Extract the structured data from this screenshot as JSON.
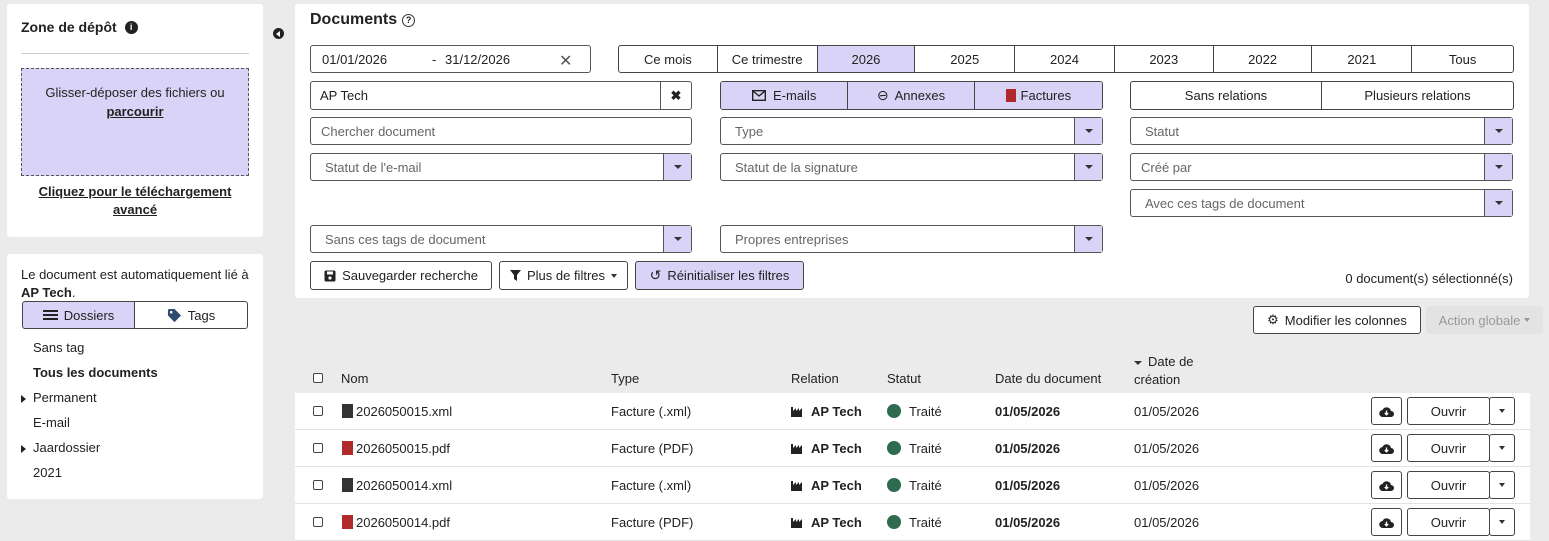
{
  "dropzone": {
    "title": "Zone de dépôt",
    "drop_text": "Glisser-déposer des fichiers ou",
    "browse_link": "parcourir",
    "advanced_upload": "Cliquez pour le téléchargement avancé"
  },
  "sidebar": {
    "info_prefix": "Le document est automatiquement lié à ",
    "info_entity": "AP Tech",
    "info_suffix": ".",
    "tabs": {
      "folders": "Dossiers",
      "tags": "Tags"
    },
    "tree": [
      {
        "label": "Sans tag",
        "bold": false,
        "expandable": false
      },
      {
        "label": "Tous les documents",
        "bold": true,
        "expandable": false
      },
      {
        "label": "Permanent",
        "bold": false,
        "expandable": true
      },
      {
        "label": "E-mail",
        "bold": false,
        "expandable": false
      },
      {
        "label": "Jaardossier",
        "bold": false,
        "expandable": true
      },
      {
        "label": "2021",
        "bold": false,
        "expandable": false
      }
    ]
  },
  "filters": {
    "title": "Documents",
    "date_from": "01/01/2026",
    "date_sep": "-",
    "date_to": "31/12/2026",
    "periods": [
      "Ce mois",
      "Ce trimestre",
      "2026",
      "2025",
      "2024",
      "2023",
      "2022",
      "2021",
      "Tous"
    ],
    "active_period": "2026",
    "company": "AP Tech",
    "doc_types": {
      "emails": "E-mails",
      "annexes": "Annexes",
      "invoices": "Factures"
    },
    "relations": {
      "none": "Sans relations",
      "multiple": "Plusieurs relations"
    },
    "search_placeholder": "Chercher document",
    "type_placeholder": "Type",
    "status_placeholder": "Statut",
    "email_status_placeholder": "Statut de l'e-mail",
    "signature_status_placeholder": "Statut de la signature",
    "created_by_placeholder": "Créé par",
    "with_tags_placeholder": "Avec ces tags de document",
    "without_tags_placeholder": "Sans ces tags de document",
    "own_companies_placeholder": "Propres entreprises",
    "save_search": "Sauvegarder recherche",
    "more_filters": "Plus de filtres",
    "reset_filters": "Réinitialiser les filtres",
    "selected_count": "0 document(s) sélectionné(s)"
  },
  "toolbar": {
    "edit_columns": "Modifier les colonnes",
    "global_action": "Action globale"
  },
  "table": {
    "headers": {
      "name": "Nom",
      "type": "Type",
      "relation": "Relation",
      "status": "Statut",
      "doc_date": "Date du document",
      "created_line1": "Date de",
      "created_line2": "création"
    },
    "open_label": "Ouvrir",
    "rows": [
      {
        "name": "2026050015.xml",
        "filetype": "xml",
        "type": "Facture (.xml)",
        "relation": "AP Tech",
        "status": "Traité",
        "doc_date": "01/05/2026",
        "created": "01/05/2026"
      },
      {
        "name": "2026050015.pdf",
        "filetype": "pdf",
        "type": "Facture (PDF)",
        "relation": "AP Tech",
        "status": "Traité",
        "doc_date": "01/05/2026",
        "created": "01/05/2026"
      },
      {
        "name": "2026050014.xml",
        "filetype": "xml",
        "type": "Facture (.xml)",
        "relation": "AP Tech",
        "status": "Traité",
        "doc_date": "01/05/2026",
        "created": "01/05/2026"
      },
      {
        "name": "2026050014.pdf",
        "filetype": "pdf",
        "type": "Facture (PDF)",
        "relation": "AP Tech",
        "status": "Traité",
        "doc_date": "01/05/2026",
        "created": "01/05/2026"
      }
    ]
  },
  "colors": {
    "accent": "#d9d4f7",
    "status_done": "#2e6b4f",
    "pdf": "#b02a2a"
  }
}
